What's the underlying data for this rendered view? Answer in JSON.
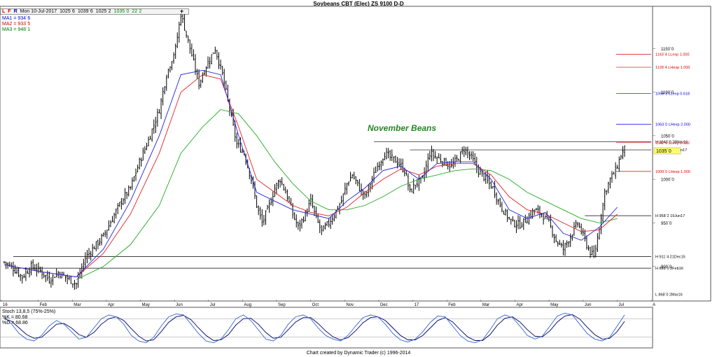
{
  "title": "Soybeans CBT (Elec) ZS 9100 D-D",
  "toolbar": {
    "items": [
      "L",
      "F",
      "R"
    ],
    "date": "Mon 10-Jul-2017",
    "open": "1025`6",
    "high": "1039`6",
    "low": "1025`2",
    "close": "1035`0",
    "change": "22`2",
    "plus": "+"
  },
  "ma_legend": [
    {
      "label": "MA1 = 934`6",
      "color": "#0000cc"
    },
    {
      "label": "MA2 = 933`5",
      "color": "#cc0000"
    },
    {
      "label": "MA3 = 948`1",
      "color": "#007700"
    }
  ],
  "annotation": "November Beans",
  "stoch": {
    "title": "Stoch 13,8,5 (75%-25%)",
    "k": "%K = 80.68",
    "d": "%D = 68.86"
  },
  "footer": "Chart created by Dynamic Trader  (c) 1996-2014",
  "chart_data": {
    "type": "ohlc",
    "price_axis": {
      "ticks": [
        "1150`0",
        "1100`0",
        "1050`0",
        "1000`0",
        "950`0",
        "900`0"
      ],
      "tick_values": [
        1150,
        1100,
        1050,
        1000,
        950,
        900
      ],
      "ylim": [
        862,
        1196
      ]
    },
    "last_price_tag": "1035`0",
    "x_axis": {
      "labels": [
        "16",
        "Feb",
        "Mar",
        "Apr",
        "May",
        "Jun",
        "Jul",
        "Aug",
        "Sep",
        "Oct",
        "Nov",
        "Dec",
        "17",
        "Feb",
        "Mar",
        "Apr",
        "May",
        "Jun",
        "Jul",
        "A"
      ]
    },
    "price_path": [
      [
        0,
        905
      ],
      [
        5,
        898
      ],
      [
        10,
        888
      ],
      [
        15,
        900
      ],
      [
        20,
        895
      ],
      [
        25,
        885
      ],
      [
        30,
        893
      ],
      [
        40,
        880
      ],
      [
        45,
        910
      ],
      [
        55,
        935
      ],
      [
        65,
        975
      ],
      [
        70,
        990
      ],
      [
        75,
        1020
      ],
      [
        80,
        1045
      ],
      [
        86,
        1080
      ],
      [
        90,
        1120
      ],
      [
        95,
        1150
      ],
      [
        98,
        1190
      ],
      [
        103,
        1150
      ],
      [
        108,
        1110
      ],
      [
        112,
        1130
      ],
      [
        117,
        1150
      ],
      [
        121,
        1120
      ],
      [
        125,
        1080
      ],
      [
        129,
        1040
      ],
      [
        133,
        1030
      ],
      [
        137,
        1000
      ],
      [
        140,
        970
      ],
      [
        143,
        950
      ],
      [
        147,
        970
      ],
      [
        150,
        990
      ],
      [
        153,
        1000
      ],
      [
        157,
        980
      ],
      [
        160,
        960
      ],
      [
        163,
        945
      ],
      [
        167,
        960
      ],
      [
        170,
        975
      ],
      [
        173,
        955
      ],
      [
        176,
        940
      ],
      [
        180,
        950
      ],
      [
        183,
        960
      ],
      [
        187,
        975
      ],
      [
        190,
        995
      ],
      [
        193,
        1005
      ],
      [
        197,
        990
      ],
      [
        200,
        980
      ],
      [
        204,
        1000
      ],
      [
        207,
        1015
      ],
      [
        211,
        1030
      ],
      [
        214,
        1025
      ],
      [
        218,
        1020
      ],
      [
        222,
        1010
      ],
      [
        225,
        985
      ],
      [
        228,
        995
      ],
      [
        232,
        1000
      ],
      [
        236,
        1030
      ],
      [
        240,
        1025
      ],
      [
        244,
        1020
      ],
      [
        248,
        1015
      ],
      [
        252,
        1025
      ],
      [
        255,
        1035
      ],
      [
        259,
        1025
      ],
      [
        263,
        1010
      ],
      [
        267,
        1000
      ],
      [
        271,
        990
      ],
      [
        274,
        975
      ],
      [
        278,
        960
      ],
      [
        282,
        950
      ],
      [
        286,
        948
      ],
      [
        290,
        955
      ],
      [
        294,
        965
      ],
      [
        298,
        960
      ],
      [
        302,
        950
      ],
      [
        306,
        930
      ],
      [
        310,
        920
      ],
      [
        314,
        935
      ],
      [
        318,
        950
      ],
      [
        321,
        935
      ],
      [
        324,
        920
      ],
      [
        327,
        910
      ],
      [
        330,
        945
      ],
      [
        333,
        985
      ],
      [
        336,
        1000
      ],
      [
        339,
        1010
      ],
      [
        342,
        1028
      ],
      [
        344,
        1035
      ]
    ],
    "ma1": [
      [
        0,
        902
      ],
      [
        20,
        894
      ],
      [
        40,
        888
      ],
      [
        55,
        920
      ],
      [
        70,
        975
      ],
      [
        86,
        1050
      ],
      [
        98,
        1120
      ],
      [
        110,
        1125
      ],
      [
        120,
        1120
      ],
      [
        130,
        1050
      ],
      [
        140,
        985
      ],
      [
        150,
        975
      ],
      [
        160,
        965
      ],
      [
        170,
        960
      ],
      [
        180,
        955
      ],
      [
        190,
        975
      ],
      [
        200,
        990
      ],
      [
        210,
        1010
      ],
      [
        220,
        1015
      ],
      [
        230,
        1000
      ],
      [
        240,
        1018
      ],
      [
        250,
        1020
      ],
      [
        260,
        1020
      ],
      [
        270,
        1000
      ],
      [
        280,
        965
      ],
      [
        290,
        955
      ],
      [
        300,
        962
      ],
      [
        310,
        938
      ],
      [
        320,
        930
      ],
      [
        330,
        945
      ],
      [
        340,
        968
      ]
    ],
    "ma2": [
      [
        0,
        902
      ],
      [
        20,
        894
      ],
      [
        40,
        888
      ],
      [
        55,
        915
      ],
      [
        70,
        960
      ],
      [
        86,
        1030
      ],
      [
        98,
        1100
      ],
      [
        110,
        1120
      ],
      [
        120,
        1115
      ],
      [
        130,
        1060
      ],
      [
        140,
        1000
      ],
      [
        150,
        985
      ],
      [
        160,
        970
      ],
      [
        170,
        962
      ],
      [
        180,
        958
      ],
      [
        190,
        968
      ],
      [
        200,
        985
      ],
      [
        210,
        1000
      ],
      [
        220,
        1012
      ],
      [
        230,
        1005
      ],
      [
        240,
        1015
      ],
      [
        250,
        1018
      ],
      [
        260,
        1018
      ],
      [
        270,
        1005
      ],
      [
        280,
        980
      ],
      [
        290,
        965
      ],
      [
        300,
        960
      ],
      [
        310,
        950
      ],
      [
        320,
        940
      ],
      [
        330,
        942
      ],
      [
        340,
        960
      ]
    ],
    "ma3": [
      [
        40,
        885
      ],
      [
        55,
        900
      ],
      [
        70,
        925
      ],
      [
        86,
        970
      ],
      [
        98,
        1030
      ],
      [
        110,
        1060
      ],
      [
        120,
        1080
      ],
      [
        130,
        1075
      ],
      [
        140,
        1050
      ],
      [
        150,
        1020
      ],
      [
        160,
        995
      ],
      [
        170,
        975
      ],
      [
        180,
        965
      ],
      [
        190,
        965
      ],
      [
        200,
        970
      ],
      [
        210,
        980
      ],
      [
        220,
        992
      ],
      [
        230,
        1000
      ],
      [
        240,
        1005
      ],
      [
        250,
        1010
      ],
      [
        260,
        1012
      ],
      [
        270,
        1010
      ],
      [
        280,
        1000
      ],
      [
        290,
        985
      ],
      [
        300,
        975
      ],
      [
        310,
        965
      ],
      [
        320,
        955
      ],
      [
        330,
        950
      ],
      [
        340,
        955
      ]
    ],
    "horizontal_levels": [
      {
        "label": "H 1043`0 28Nov16",
        "value": 1043,
        "color": "#000000",
        "start": 205
      },
      {
        "label": "H 1033`6 19Jan17",
        "value": 1033.75,
        "color": "#000000",
        "start": 225
      },
      {
        "label": "H 958`2 19Jun17",
        "value": 958.25,
        "color": "#000000",
        "start": 322
      },
      {
        "label": "H 911`4 21Dec15",
        "value": 911.5,
        "color": "#000000",
        "start": 5
      },
      {
        "label": "H 898`0 2Feb16",
        "value": 898,
        "color": "#000000",
        "start": 5
      },
      {
        "label": "L 868`0 2Mar16",
        "value": 868,
        "color": "#000000",
        "start": null
      }
    ],
    "projections": [
      {
        "label": "1143`4 LLexp 1.000",
        "value": 1143.5,
        "color": "#dd0000"
      },
      {
        "label": "1128`4 LHexp 1.000",
        "value": 1128.5,
        "color": "#dd0000"
      },
      {
        "label": "1098`3 LLexp 0.618",
        "value": 1098.4,
        "color": "#0000dd"
      },
      {
        "label": "1063`0 LHexp 2.000",
        "value": 1063,
        "color": "#0000dd"
      },
      {
        "label": "1042`0 LLexp 0.382",
        "value": 1042,
        "color": "#dd0000"
      },
      {
        "label": "1009`0 LHexp 1.000",
        "value": 1009,
        "color": "#dd0000"
      }
    ],
    "stochastic": {
      "k": [
        80,
        60,
        35,
        20,
        15,
        30,
        55,
        70,
        60,
        40,
        20,
        25,
        50,
        75,
        85,
        80,
        60,
        30,
        15,
        10,
        25,
        55,
        80,
        88,
        85,
        60,
        35,
        15,
        10,
        20,
        45,
        75,
        85,
        70,
        45,
        20,
        15,
        30,
        60,
        80,
        85,
        75,
        50,
        30,
        20,
        15,
        30,
        55,
        78,
        85,
        80,
        60,
        35,
        18,
        12,
        20,
        40,
        65,
        82,
        80,
        55,
        30,
        15,
        10,
        18,
        45,
        75,
        85,
        78,
        55,
        30,
        20,
        28,
        55,
        82,
        90,
        85,
        60,
        35,
        20,
        15,
        25,
        55,
        85
      ],
      "d": [
        75,
        68,
        50,
        32,
        22,
        25,
        42,
        60,
        62,
        50,
        32,
        25,
        38,
        60,
        75,
        80,
        70,
        48,
        28,
        15,
        18,
        40,
        65,
        80,
        84,
        72,
        50,
        30,
        16,
        18,
        32,
        58,
        75,
        76,
        60,
        38,
        22,
        25,
        45,
        66,
        78,
        78,
        62,
        42,
        26,
        18,
        24,
        42,
        64,
        78,
        80,
        70,
        50,
        30,
        18,
        18,
        30,
        50,
        70,
        78,
        66,
        45,
        26,
        16,
        16,
        32,
        58,
        76,
        80,
        66,
        45,
        28,
        26,
        42,
        66,
        82,
        86,
        74,
        52,
        32,
        20,
        22,
        40,
        68
      ]
    }
  }
}
